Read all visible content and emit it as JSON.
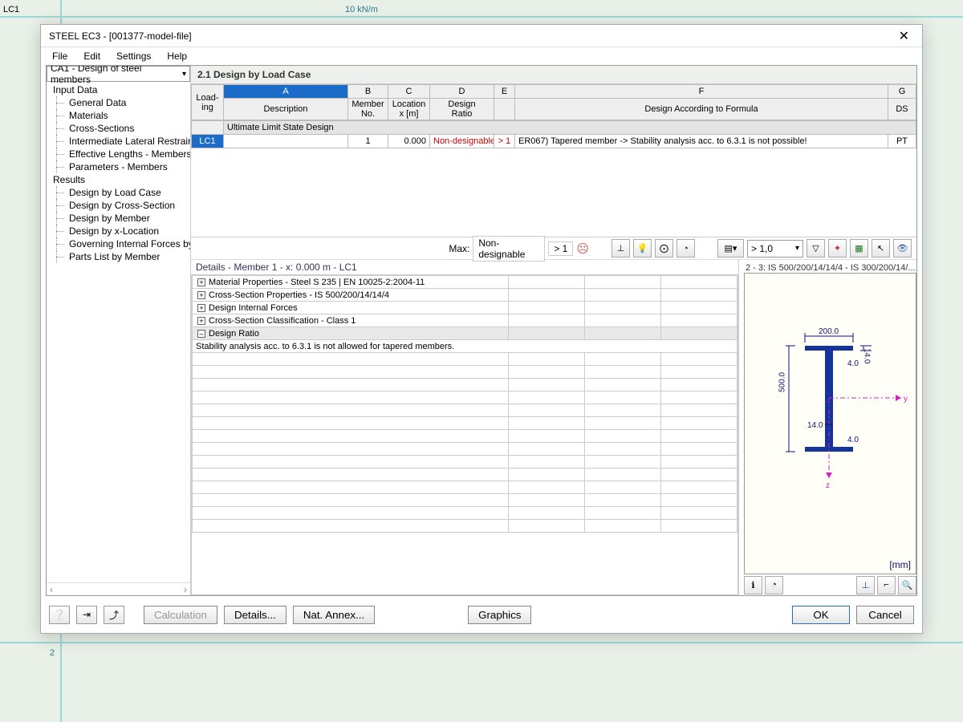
{
  "bg": {
    "loadcase": "LC1",
    "load": "10 kN/m",
    "node2": "2"
  },
  "window": {
    "title": "STEEL EC3 - [001377-model-file]"
  },
  "menu": {
    "file": "File",
    "edit": "Edit",
    "settings": "Settings",
    "help": "Help"
  },
  "nav": {
    "selector": "CA1 - Design of steel members",
    "groups": [
      {
        "label": "Input Data",
        "children": [
          "General Data",
          "Materials",
          "Cross-Sections",
          "Intermediate Lateral Restraints",
          "Effective Lengths - Members",
          "Parameters - Members"
        ]
      },
      {
        "label": "Results",
        "children": [
          "Design by Load Case",
          "Design by Cross-Section",
          "Design by Member",
          "Design by x-Location",
          "Governing Internal Forces by Member",
          "Parts List by Member"
        ]
      }
    ]
  },
  "section_title": "2.1 Design by Load Case",
  "grid": {
    "col_letters": [
      "A",
      "B",
      "C",
      "D",
      "E",
      "F",
      "G"
    ],
    "head_loading": "Load-\ning",
    "head_desc": "Description",
    "head_member": "Member\nNo.",
    "head_loc": "Location\nx [m]",
    "head_ratio": "Design\nRatio",
    "head_formula": "Design According to Formula",
    "head_ds": "DS",
    "section": "Ultimate Limit State Design",
    "row": {
      "lc": "LC1",
      "desc": "",
      "member": "1",
      "x": "0.000",
      "ratio": "Non-designable",
      "e": "> 1",
      "formula": "ER067) Tapered member -> Stability analysis acc. to 6.3.1 is not possible!",
      "ds": "PT"
    }
  },
  "toolbar": {
    "max_label": "Max:",
    "max_val": "Non-designable",
    "max_flag": "> 1",
    "filter": "> 1,0"
  },
  "details": {
    "title": "Details - Member 1 - x: 0.000 m - LC1",
    "rows": [
      {
        "exp": "+",
        "text": "Material Properties - Steel S 235 | EN 10025-2:2004-11"
      },
      {
        "exp": "+",
        "text": "Cross-Section Properties  - IS 500/200/14/14/4"
      },
      {
        "exp": "+",
        "text": "Design Internal Forces"
      },
      {
        "exp": "+",
        "text": "Cross-Section Classification - Class 1"
      },
      {
        "exp": "-",
        "text": "Design Ratio"
      },
      {
        "exp": "",
        "text": "Stability analysis acc. to 6.3.1 is not allowed for tapered members.",
        "indent": true
      }
    ]
  },
  "preview": {
    "title": "2 - 3: IS 500/200/14/14/4 - IS 300/200/14/...",
    "dims": {
      "height": "500.0",
      "flange_w": "200.0",
      "flange_t": "14.0",
      "web_t": "14.0",
      "radius": "4.0"
    },
    "unit": "[mm]",
    "axis_y": "y",
    "axis_z": "z"
  },
  "footer": {
    "calc": "Calculation",
    "details": "Details...",
    "annex": "Nat. Annex...",
    "graphics": "Graphics",
    "ok": "OK",
    "cancel": "Cancel"
  }
}
